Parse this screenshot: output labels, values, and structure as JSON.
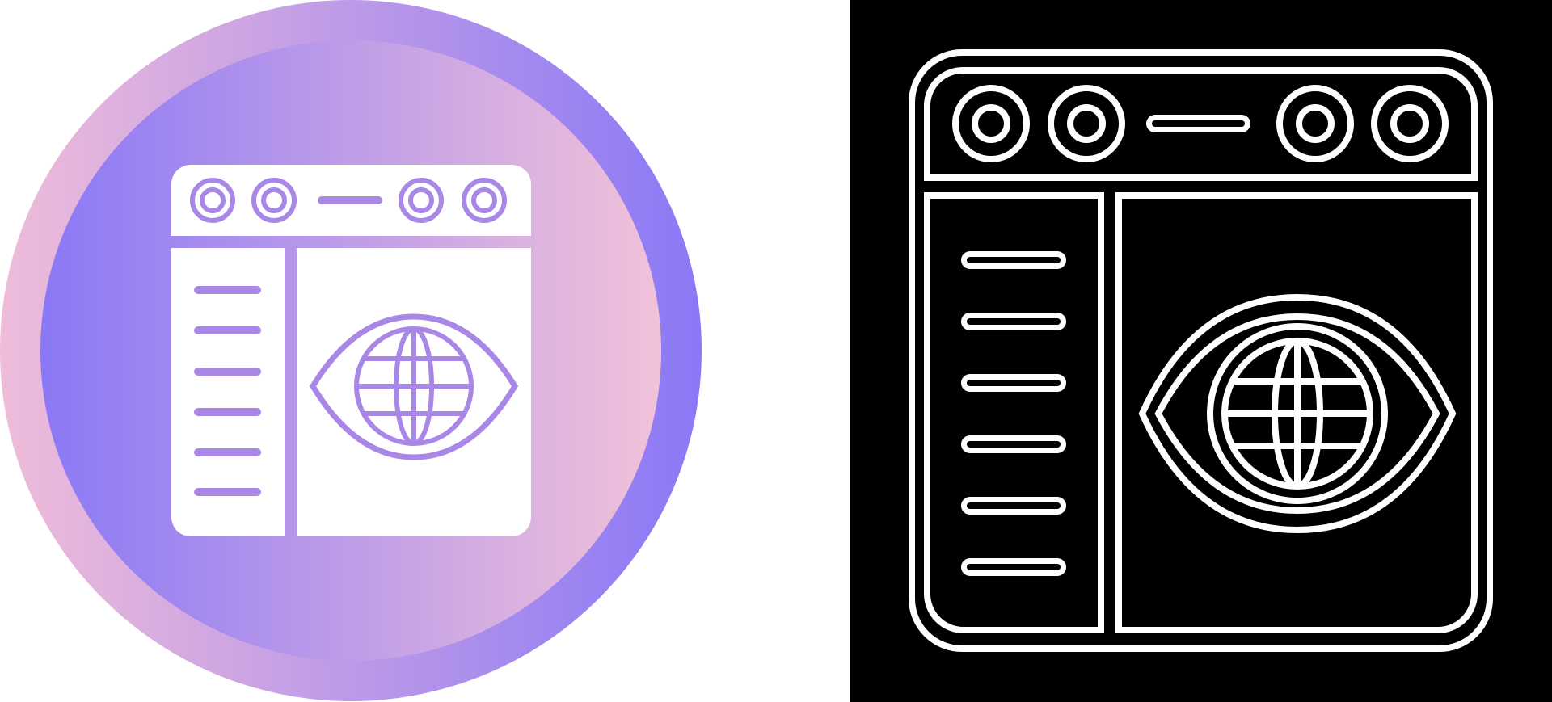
{
  "icons": [
    {
      "name": "web-monitoring-icon",
      "variant": "gradient-circle",
      "colors": {
        "outer_gradient_start": "#efbcd9",
        "outer_gradient_end": "#8a78f6",
        "inner_gradient_start": "#8a78f6",
        "inner_gradient_end": "#f2c2d9",
        "glyph_fill": "#ffffff",
        "glyph_stroke": "#a987e6"
      }
    },
    {
      "name": "web-monitoring-icon",
      "variant": "black-outline",
      "colors": {
        "background": "#000000",
        "stroke": "#ffffff"
      }
    }
  ]
}
